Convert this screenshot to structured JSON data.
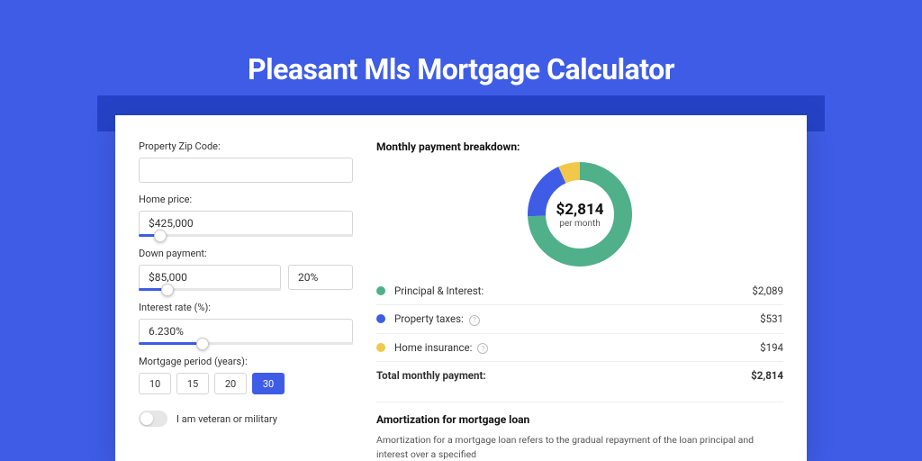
{
  "title": "Pleasant Mls Mortgage Calculator",
  "form": {
    "zip_label": "Property Zip Code:",
    "zip_value": "",
    "home_price_label": "Home price:",
    "home_price_value": "$425,000",
    "home_price_slider_pct": 10,
    "down_payment_label": "Down payment:",
    "down_payment_value": "$85,000",
    "down_payment_pct_value": "20%",
    "down_payment_slider_pct": 20,
    "interest_label": "Interest rate (%):",
    "interest_value": "6.230%",
    "interest_slider_pct": 30,
    "period_label": "Mortgage period (years):",
    "periods": [
      "10",
      "15",
      "20",
      "30"
    ],
    "period_active": "30",
    "veteran_label": "I am veteran or military"
  },
  "breakdown": {
    "heading": "Monthly payment breakdown:",
    "donut_amount": "$2,814",
    "donut_sub": "per month",
    "rows": [
      {
        "name": "Principal & Interest:",
        "value": "$2,089",
        "color": "#4FB08A",
        "info": false
      },
      {
        "name": "Property taxes:",
        "value": "$531",
        "color": "#3E5CE6",
        "info": true
      },
      {
        "name": "Home insurance:",
        "value": "$194",
        "color": "#F2C84B",
        "info": true
      }
    ],
    "total_name": "Total monthly payment:",
    "total_value": "$2,814"
  },
  "amort": {
    "heading": "Amortization for mortgage loan",
    "body": "Amortization for a mortgage loan refers to the gradual repayment of the loan principal and interest over a specified"
  },
  "chart_data": {
    "type": "pie",
    "title": "Monthly payment breakdown",
    "series": [
      {
        "name": "Principal & Interest",
        "value": 2089,
        "color": "#4FB08A"
      },
      {
        "name": "Property taxes",
        "value": 531,
        "color": "#3E5CE6"
      },
      {
        "name": "Home insurance",
        "value": 194,
        "color": "#F2C84B"
      }
    ],
    "total": 2814,
    "center_label": "$2,814",
    "center_sublabel": "per month"
  }
}
